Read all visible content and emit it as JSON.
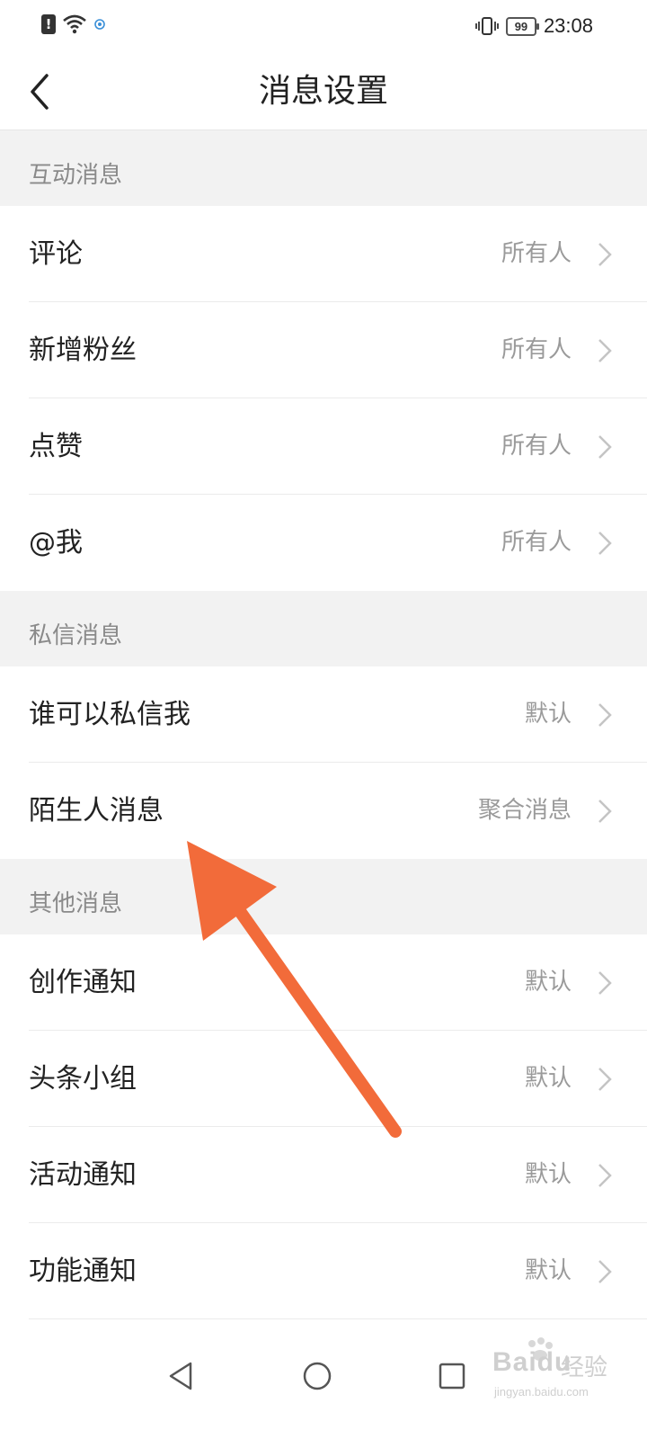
{
  "status_bar": {
    "time": "23:08",
    "battery": "99",
    "icons": [
      "alert-icon",
      "wifi-icon",
      "notification-icon",
      "vibrate-icon",
      "battery-icon"
    ]
  },
  "header": {
    "title": "消息设置",
    "back_icon": "back-icon"
  },
  "sections": [
    {
      "title": "互动消息",
      "items": [
        {
          "label": "评论",
          "value": "所有人"
        },
        {
          "label": "新增粉丝",
          "value": "所有人"
        },
        {
          "label": "点赞",
          "value": "所有人"
        },
        {
          "label": "@我",
          "value": "所有人"
        }
      ]
    },
    {
      "title": "私信消息",
      "items": [
        {
          "label": "谁可以私信我",
          "value": "默认"
        },
        {
          "label": "陌生人消息",
          "value": "聚合消息"
        }
      ]
    },
    {
      "title": "其他消息",
      "items": [
        {
          "label": "创作通知",
          "value": "默认"
        },
        {
          "label": "头条小组",
          "value": "默认"
        },
        {
          "label": "活动通知",
          "value": "默认"
        },
        {
          "label": "功能通知",
          "value": "默认"
        }
      ]
    }
  ],
  "annotation": {
    "color": "#f26b3a"
  },
  "bottom_nav": {
    "icons": [
      "back-triangle-icon",
      "home-circle-icon",
      "recents-square-icon"
    ]
  },
  "watermark": {
    "brand": "Baidu",
    "suffix": "经验",
    "url": "jingyan.baidu.com"
  },
  "colors": {
    "section_bg": "#f2f2f2",
    "section_text": "#8a8a8a",
    "item_text": "#222222",
    "value_text": "#9a9a9a"
  }
}
